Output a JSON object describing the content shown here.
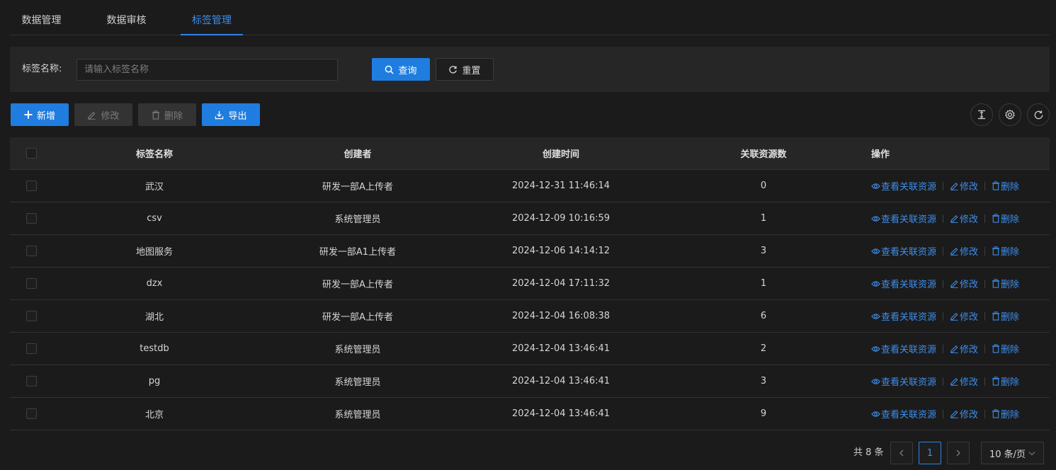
{
  "tabs": [
    {
      "label": "数据管理",
      "active": false
    },
    {
      "label": "数据审核",
      "active": false
    },
    {
      "label": "标签管理",
      "active": true
    }
  ],
  "search": {
    "label": "标签名称:",
    "placeholder": "请输入标签名称",
    "value": "",
    "query_label": "查询",
    "reset_label": "重置"
  },
  "toolbar": {
    "add_label": "新增",
    "edit_label": "修改",
    "delete_label": "删除",
    "export_label": "导出",
    "icons": [
      "column-height-icon",
      "settings-icon",
      "refresh-icon"
    ]
  },
  "table": {
    "columns": [
      "标签名称",
      "创建者",
      "创建时间",
      "关联资源数",
      "操作"
    ],
    "rows": [
      {
        "name": "武汉",
        "creator": "研发一部A上传者",
        "created": "2024-12-31 11:46:14",
        "count": "0"
      },
      {
        "name": "csv",
        "creator": "系统管理员",
        "created": "2024-12-09 10:16:59",
        "count": "1"
      },
      {
        "name": "地图服务",
        "creator": "研发一部A1上传者",
        "created": "2024-12-06 14:14:12",
        "count": "3"
      },
      {
        "name": "dzx",
        "creator": "研发一部A上传者",
        "created": "2024-12-04 17:11:32",
        "count": "1"
      },
      {
        "name": "湖北",
        "creator": "研发一部A上传者",
        "created": "2024-12-04 16:08:38",
        "count": "6"
      },
      {
        "name": "testdb",
        "creator": "系统管理员",
        "created": "2024-12-04 13:46:41",
        "count": "2"
      },
      {
        "name": "pg",
        "creator": "系统管理员",
        "created": "2024-12-04 13:46:41",
        "count": "3"
      },
      {
        "name": "北京",
        "creator": "系统管理员",
        "created": "2024-12-04 13:46:41",
        "count": "9"
      }
    ],
    "actions": {
      "view": "查看关联资源",
      "edit": "修改",
      "delete": "删除"
    }
  },
  "pagination": {
    "total_text": "共 8 条",
    "current_page": "1",
    "page_size": "10 条/页"
  },
  "colors": {
    "accent": "#1f7de0",
    "link": "#3d8eea",
    "background": "#1b1b1c",
    "panel": "#262627"
  }
}
